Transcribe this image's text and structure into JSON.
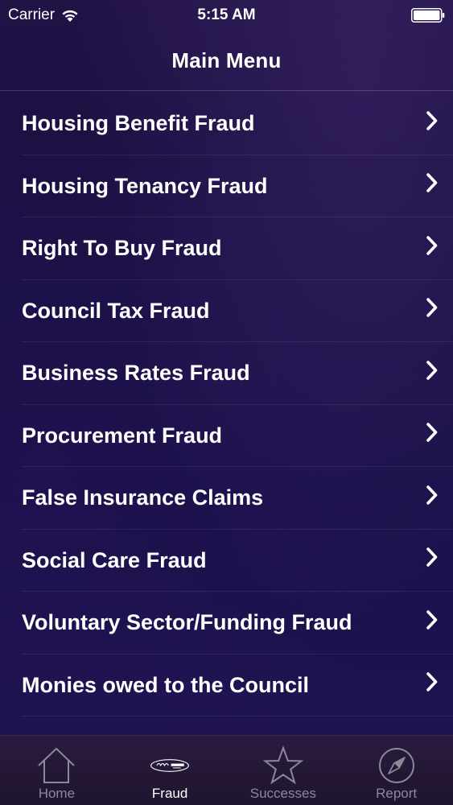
{
  "status_bar": {
    "carrier": "Carrier",
    "time": "5:15 AM"
  },
  "nav": {
    "title": "Main Menu"
  },
  "menu": {
    "items": [
      {
        "label": "Housing Benefit Fraud"
      },
      {
        "label": "Housing Tenancy Fraud"
      },
      {
        "label": "Right To Buy Fraud"
      },
      {
        "label": "Council Tax Fraud"
      },
      {
        "label": "Business Rates Fraud"
      },
      {
        "label": "Procurement Fraud"
      },
      {
        "label": "False Insurance Claims"
      },
      {
        "label": "Social Care Fraud"
      },
      {
        "label": "Voluntary Sector/Funding Fraud"
      },
      {
        "label": "Monies owed to the Council"
      }
    ]
  },
  "tab_bar": {
    "tabs": [
      {
        "label": "Home",
        "icon": "house-icon",
        "active": false
      },
      {
        "label": "Fraud",
        "icon": "council-logo-icon",
        "active": true
      },
      {
        "label": "Successes",
        "icon": "star-icon",
        "active": false
      },
      {
        "label": "Report",
        "icon": "compass-icon",
        "active": false
      }
    ]
  },
  "colors": {
    "background": "#1a1049",
    "tab_bar": "#241733",
    "active_tab_label": "#ffffff",
    "inactive_tab_label": "#8c8a96"
  }
}
